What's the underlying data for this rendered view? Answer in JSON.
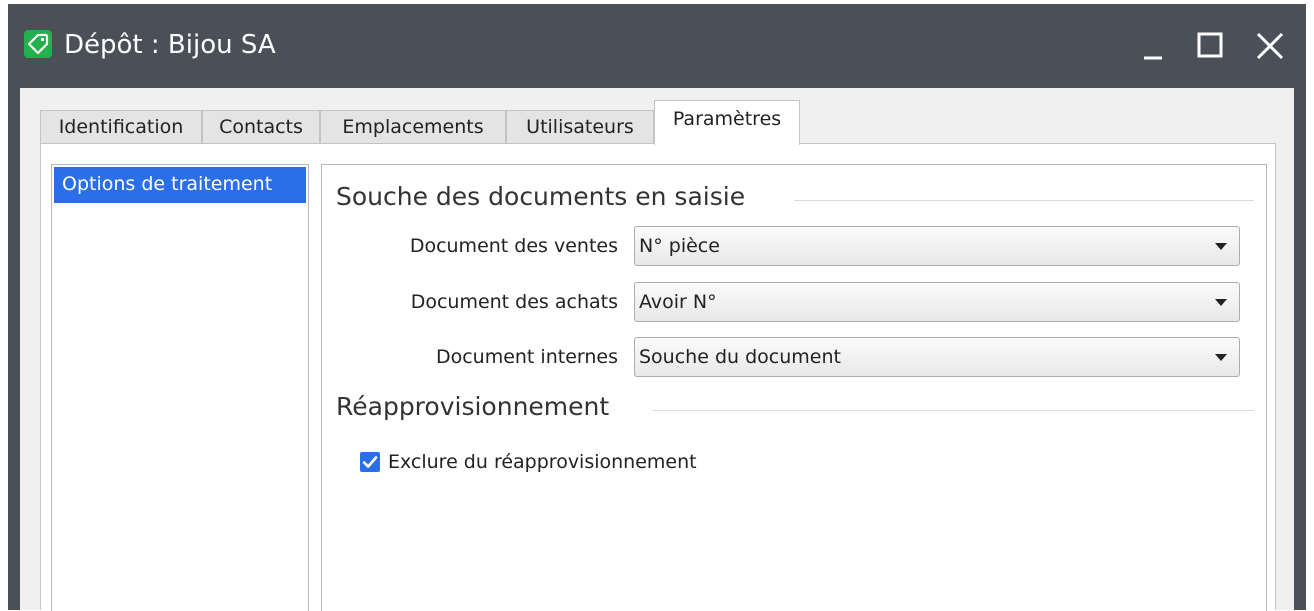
{
  "window": {
    "title": "Dépôt : Bijou SA",
    "accent": "#22b14c",
    "titlebar_color": "#4b4f57"
  },
  "tabs": [
    {
      "label": "Identification",
      "active": false
    },
    {
      "label": "Contacts",
      "active": false
    },
    {
      "label": "Emplacements",
      "active": false
    },
    {
      "label": "Utilisateurs",
      "active": false
    },
    {
      "label": "Paramètres",
      "active": true
    }
  ],
  "sidebar": {
    "items": [
      {
        "label": "Options de traitement",
        "selected": true
      }
    ],
    "selection_color": "#2a6ee8"
  },
  "sections": {
    "souche": {
      "title": "Souche des documents en saisie",
      "fields": [
        {
          "label": "Document des ventes",
          "value": "N° pièce"
        },
        {
          "label": "Document des achats",
          "value": "Avoir N°"
        },
        {
          "label": "Document internes",
          "value": "Souche du document"
        }
      ]
    },
    "reappro": {
      "title": "Réapprovisionnement",
      "checkbox": {
        "label": "Exclure du réapprovisionnement",
        "checked": true
      }
    }
  },
  "icons": {
    "app": "tag-icon",
    "minimize": "minimize-icon",
    "maximize": "maximize-icon",
    "close": "close-icon",
    "dropdown": "chevron-down-icon",
    "check": "checkmark-icon"
  }
}
